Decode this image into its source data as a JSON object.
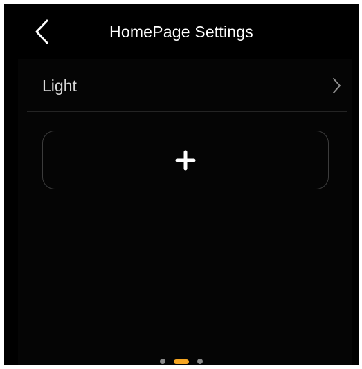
{
  "header": {
    "title": "HomePage Settings",
    "back_icon": "chevron-left-icon"
  },
  "settings": [
    {
      "label": "Light",
      "chevron_icon": "chevron-right-icon"
    }
  ],
  "add_card": {
    "icon": "plus-icon"
  },
  "pager": {
    "current_page": 2,
    "total_pages": 3
  },
  "colors": {
    "background": "#000000",
    "content_background": "#050505",
    "title_text": "#ffffff",
    "setting_text": "#d9d9d9",
    "accent": "#f5a623",
    "inactive_dot": "#8a8a8a",
    "divider": "#555555",
    "card_border": "#3c3c3c"
  }
}
